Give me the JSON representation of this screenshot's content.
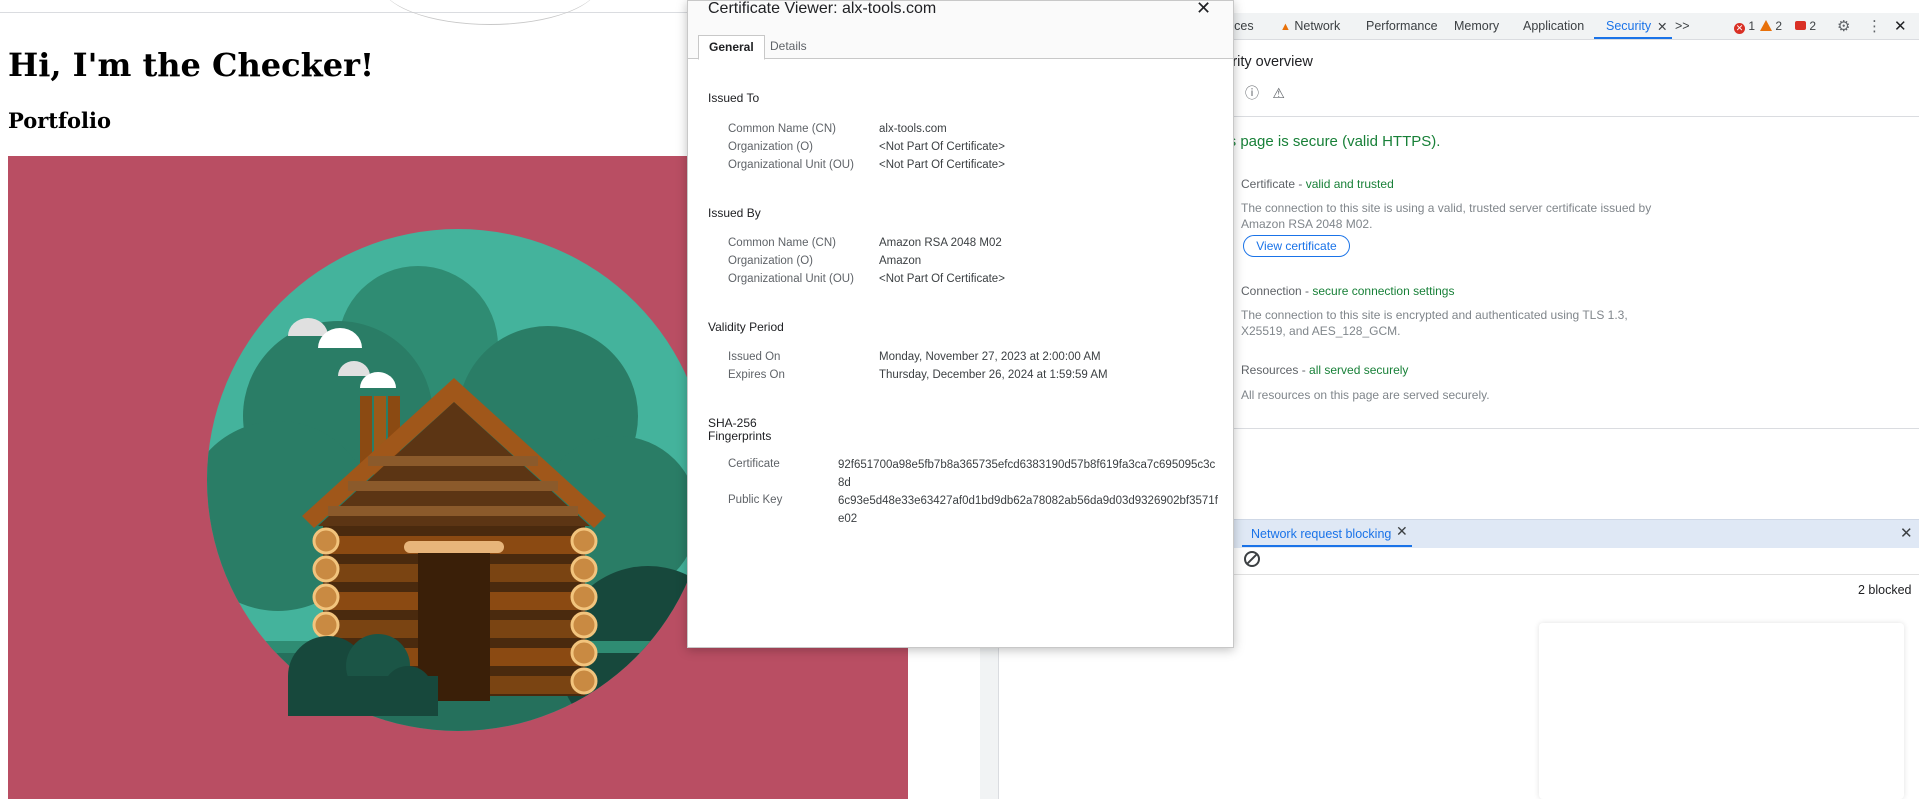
{
  "page": {
    "heading": "Hi, I'm the Checker!",
    "subheading": "Portfolio"
  },
  "devtools": {
    "tabs": [
      {
        "label": "rces"
      },
      {
        "label": "Network"
      },
      {
        "label": "Performance"
      },
      {
        "label": "Memory"
      },
      {
        "label": "Application"
      },
      {
        "label": "Security"
      }
    ],
    "overflow_label": ">>",
    "issue_counts": {
      "errors": "1",
      "warnings": "2",
      "messages": "2"
    },
    "security": {
      "title": "curity overview",
      "headline": "his page is secure (valid HTTPS).",
      "certificate_label": "Certificate - ",
      "certificate_status": "valid and trusted",
      "certificate_desc": "The connection to this site is using a valid, trusted server certificate issued by Amazon RSA 2048 M02.",
      "view_certificate_button": "View certificate",
      "connection_label": "Connection - ",
      "connection_status": "secure connection settings",
      "connection_desc": "The connection to this site is encrypted and authenticated using TLS 1.3, X25519, and AES_128_GCM.",
      "resources_label": "Resources - ",
      "resources_status": "all served securely",
      "resources_desc": "All resources on this page are served securely."
    },
    "drawer": {
      "tab_label": "Network request blocking",
      "blocked_count": "2 blocked"
    }
  },
  "certificate_viewer": {
    "title": "Certificate Viewer: alx-tools.com",
    "tabs": [
      "General",
      "Details"
    ],
    "issued_to": {
      "heading": "Issued To",
      "fields": [
        {
          "key": "Common Name (CN)",
          "value": "alx-tools.com"
        },
        {
          "key": "Organization (O)",
          "value": "<Not Part Of Certificate>"
        },
        {
          "key": "Organizational Unit (OU)",
          "value": "<Not Part Of Certificate>"
        }
      ]
    },
    "issued_by": {
      "heading": "Issued By",
      "fields": [
        {
          "key": "Common Name (CN)",
          "value": "Amazon RSA 2048 M02"
        },
        {
          "key": "Organization (O)",
          "value": "Amazon"
        },
        {
          "key": "Organizational Unit (OU)",
          "value": "<Not Part Of Certificate>"
        }
      ]
    },
    "validity": {
      "heading": "Validity Period",
      "fields": [
        {
          "key": "Issued On",
          "value": "Monday, November 27, 2023 at 2:00:00 AM"
        },
        {
          "key": "Expires On",
          "value": "Thursday, December 26, 2024 at 1:59:59 AM"
        }
      ]
    },
    "fingerprints": {
      "heading_line1": "SHA-256",
      "heading_line2": "Fingerprints",
      "fields": [
        {
          "key": "Certificate",
          "value": "92f651700a98e5fb7b8a365735efcd6383190d57b8f619fa3ca7c695095c3c8d"
        },
        {
          "key": "Public Key",
          "value": "6c93e5d48e33e63427af0d1bd9db62a78082ab56da9d03d9326902bf3571fe02"
        }
      ]
    }
  }
}
